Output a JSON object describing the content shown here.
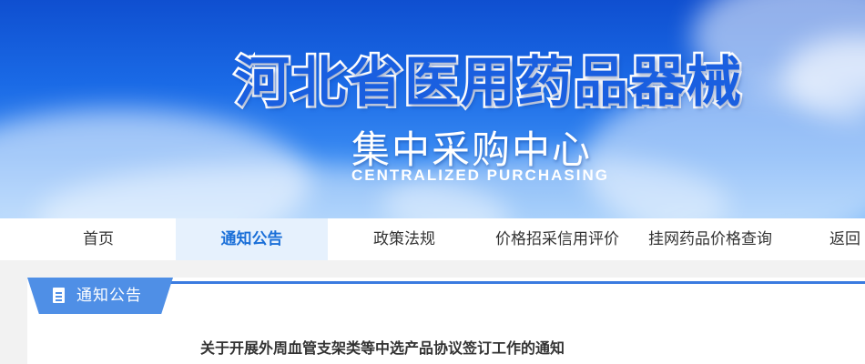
{
  "banner": {
    "title": "河北省医用药品器械",
    "subtitle": "集中采购中心",
    "subtitle_en": "CENTRALIZED PURCHASING"
  },
  "nav": {
    "items": [
      {
        "label": "首页",
        "active": false
      },
      {
        "label": "通知公告",
        "active": true
      },
      {
        "label": "政策法规",
        "active": false
      },
      {
        "label": "价格招采信用评价",
        "active": false
      },
      {
        "label": "挂网药品价格查询",
        "active": false
      },
      {
        "label": "返回",
        "active": false
      }
    ]
  },
  "section": {
    "tab_label": "通知公告",
    "tab_icon": "document-icon"
  },
  "article": {
    "title": "关于开展外周血管支架类等中选产品协议签订工作的通知"
  },
  "colors": {
    "accent": "#1a6fd8",
    "tab_bg": "#4f8fe6",
    "nav_active_bg": "#e6f1fd"
  }
}
